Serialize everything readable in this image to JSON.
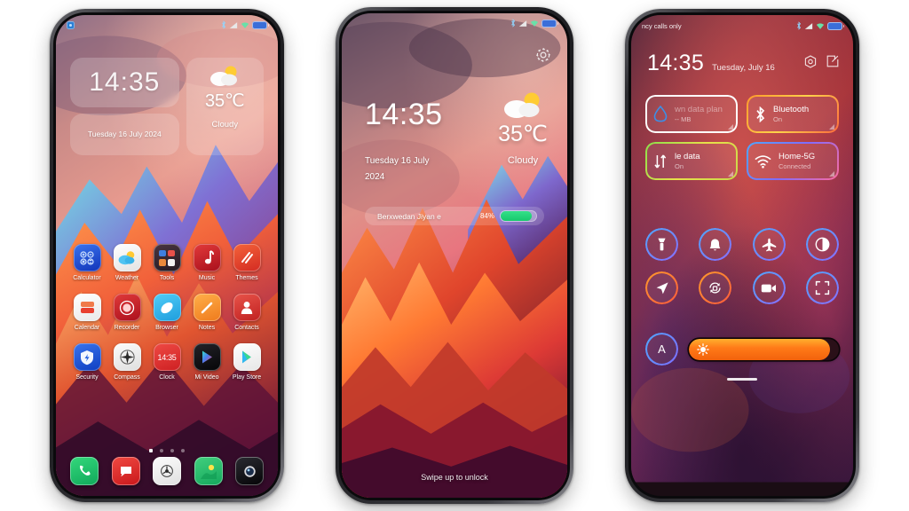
{
  "meta": {
    "background": "#ffffff",
    "phone_count": 3
  },
  "phone1": {
    "name": "home-screen",
    "statusbar": {
      "icons": [
        "bluetooth-icon",
        "signal-icon",
        "wifi-icon",
        "battery-icon"
      ],
      "notch_icon": "app-badge-icon"
    },
    "widgets": {
      "clock": "14:35",
      "date": "Tuesday 16 July 2024",
      "weather": {
        "icon": "partly-cloudy-icon",
        "temp": "35℃",
        "condition": "Cloudy"
      }
    },
    "apps": [
      [
        {
          "label": "Calculator",
          "icon": "calculator-icon",
          "color": "#1a4fd6"
        },
        {
          "label": "Weather",
          "icon": "weather-icon",
          "color": "#f2f2f2"
        },
        {
          "label": "Tools",
          "icon": "tools-folder-icon",
          "color": "#3a2b33"
        },
        {
          "label": "Music",
          "icon": "music-note-icon",
          "color": "#d0252a"
        },
        {
          "label": "Themes",
          "icon": "themes-icon",
          "color": "#e8452c"
        }
      ],
      [
        {
          "label": "Calendar",
          "icon": "calendar-icon",
          "color": "#f7f7f7"
        },
        {
          "label": "Recorder",
          "icon": "recorder-icon",
          "color": "#cf2130"
        },
        {
          "label": "Browser",
          "icon": "browser-icon",
          "color": "#36b8f0"
        },
        {
          "label": "Notes",
          "icon": "notes-icon",
          "color": "#f0922a"
        },
        {
          "label": "Contacts",
          "icon": "contacts-icon",
          "color": "#d8352c"
        }
      ],
      [
        {
          "label": "Security",
          "icon": "shield-icon",
          "color": "#1b59e0"
        },
        {
          "label": "Compass",
          "icon": "compass-icon",
          "color": "#ededed"
        },
        {
          "label": "Clock",
          "icon": "clock-icon",
          "color": "#e8342f"
        },
        {
          "label": "Mi Video",
          "icon": "video-play-icon",
          "color": "#101014"
        },
        {
          "label": "Play Store",
          "icon": "play-store-icon",
          "color": "#fafafa"
        }
      ]
    ],
    "clock_icon_time": "14:35",
    "page_dots": {
      "count": 4,
      "active": 0
    },
    "dock": [
      {
        "label": "Phone",
        "icon": "phone-icon",
        "color": "#1fc46b"
      },
      {
        "label": "Messages",
        "icon": "message-icon",
        "color": "#e32b28"
      },
      {
        "label": "Mi Browser",
        "icon": "mi-browser-icon",
        "color": "#f0f0f0"
      },
      {
        "label": "Gallery",
        "icon": "gallery-icon",
        "color": "#2bbf6b"
      },
      {
        "label": "Camera",
        "icon": "camera-icon",
        "color": "#151518"
      }
    ]
  },
  "phone2": {
    "name": "lock-screen",
    "statusbar": {
      "icons": [
        "bluetooth-icon",
        "signal-icon",
        "wifi-icon",
        "battery-icon"
      ]
    },
    "settings_icon": "gear-icon",
    "clock": "14:35",
    "date_line1": "Tuesday 16 July",
    "date_line2": "2024",
    "weather": {
      "icon": "partly-cloudy-icon",
      "temp": "35℃",
      "condition": "Cloudy"
    },
    "battery_card": {
      "name": "Berxwedan Jiyan e",
      "percent": "84%",
      "level": 84
    },
    "hint": "Swipe up to unlock"
  },
  "phone3": {
    "name": "control-center",
    "carrier": "ncy calls only",
    "statusbar": {
      "icons": [
        "bluetooth-icon",
        "signal-icon",
        "wifi-icon",
        "battery-icon"
      ]
    },
    "clock": "14:35",
    "date": "Tuesday, July 16",
    "header_actions": [
      {
        "icon": "settings-hex-icon"
      },
      {
        "icon": "edit-icon"
      }
    ],
    "tiles": [
      {
        "name": "wn data plan",
        "status": "--  MB",
        "icon": "data-drop-icon",
        "ring": "#ffffff"
      },
      {
        "name": "Bluetooth",
        "status": "On",
        "icon": "bluetooth-icon",
        "ring": "#ff8a2b"
      },
      {
        "name": "le data",
        "status": "On",
        "icon": "mobile-data-icon",
        "ring": "#c8e04a"
      },
      {
        "name": "Home-5G",
        "status": "Connected",
        "icon": "wifi-icon",
        "ring": "#4da8ff"
      }
    ],
    "toggles": [
      {
        "icon": "flashlight-icon",
        "ring": "#4da8ff"
      },
      {
        "icon": "bell-icon",
        "ring": "#4da8ff"
      },
      {
        "icon": "airplane-icon",
        "ring": "#4da8ff"
      },
      {
        "icon": "dark-mode-icon",
        "ring": "#4da8ff"
      },
      {
        "icon": "location-icon",
        "ring": "#ff9a2b"
      },
      {
        "icon": "auto-rotate-icon",
        "ring": "#ff9a2b"
      },
      {
        "icon": "screen-record-icon",
        "ring": "#4da8ff"
      },
      {
        "icon": "scanner-icon",
        "ring": "#4da8ff"
      }
    ],
    "auto_brightness_label": "A",
    "brightness": {
      "icon": "sun-icon",
      "level": 94
    },
    "handle": "drag-handle"
  }
}
